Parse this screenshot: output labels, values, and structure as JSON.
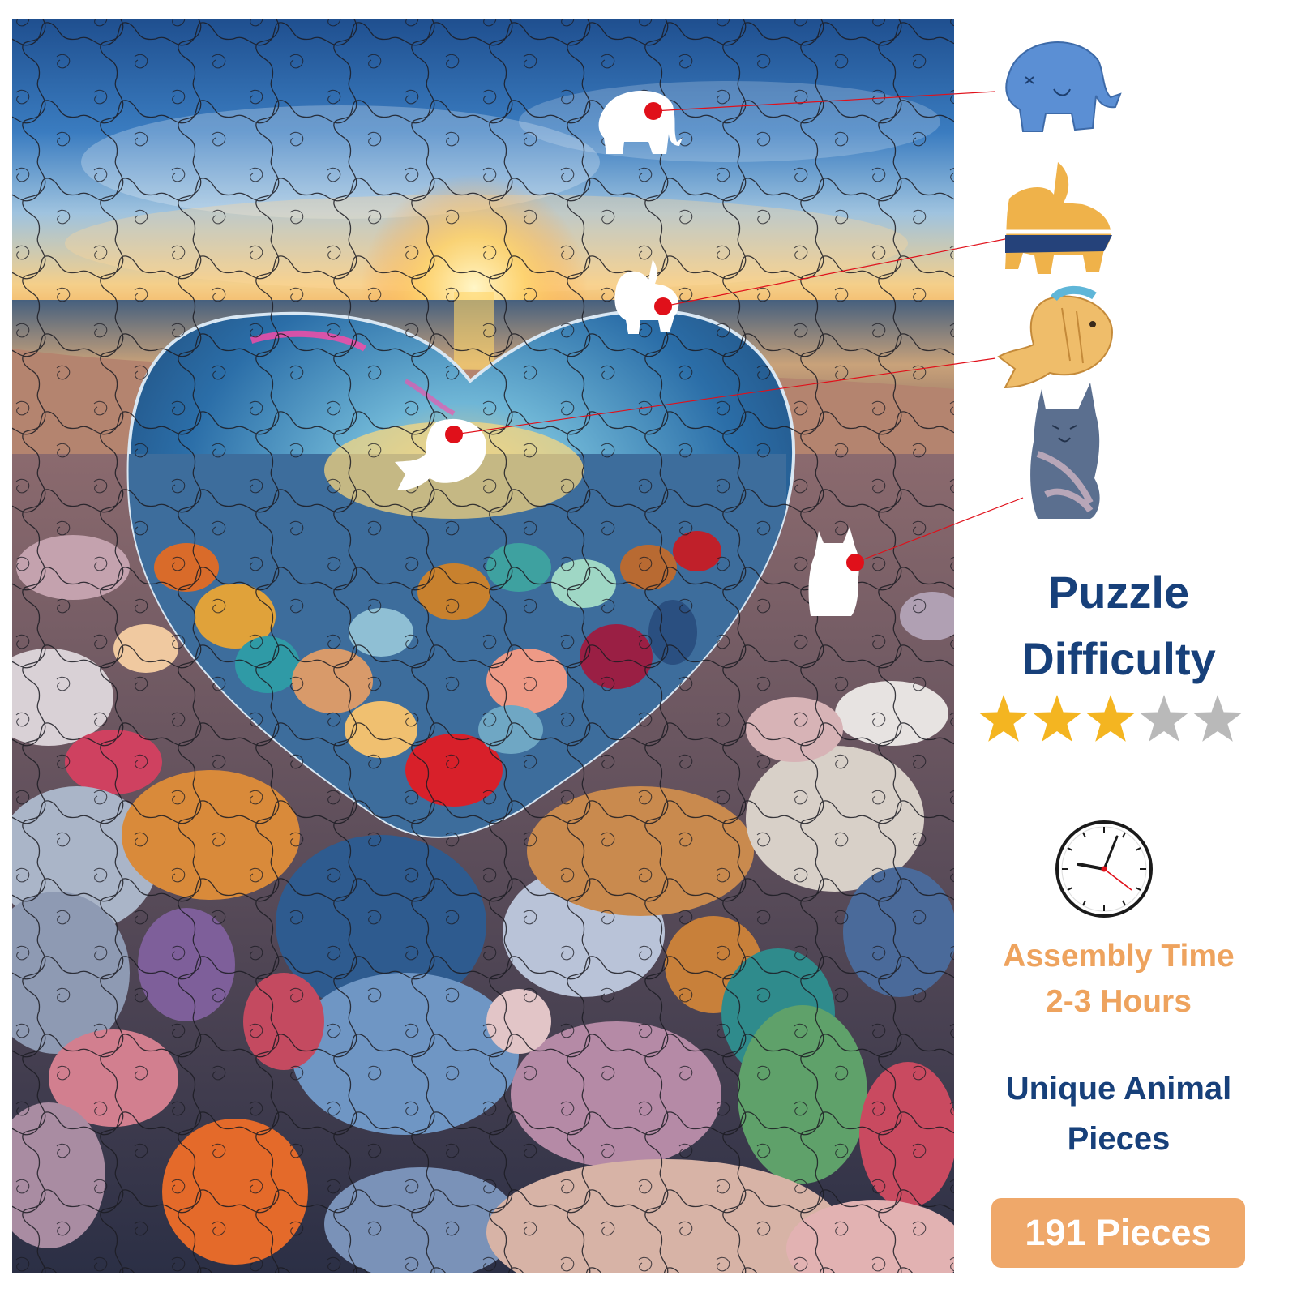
{
  "difficulty": {
    "title_line1": "Puzzle",
    "title_line2": "Difficulty",
    "rating": 3,
    "max_rating": 5,
    "star_filled_color": "#f4b521",
    "star_empty_color": "#b9b9b9"
  },
  "clock_icon": "clock-icon",
  "assembly": {
    "line1": "Assembly Time",
    "line2": "2-3 Hours"
  },
  "feature": {
    "line1": "Unique Animal",
    "line2": "Pieces"
  },
  "pieces_badge": {
    "label": "191 Pieces"
  },
  "photo": {
    "subject": "glass heart on colorful pebbles at sunset beach",
    "sample_pieces": [
      "elephant-icon",
      "goat-icon",
      "fish-icon",
      "cat-icon"
    ]
  },
  "colors": {
    "navy_text": "#17407a",
    "orange_text": "#eea35e",
    "badge_bg": "#efa86a",
    "marker_red": "#e0101a"
  }
}
